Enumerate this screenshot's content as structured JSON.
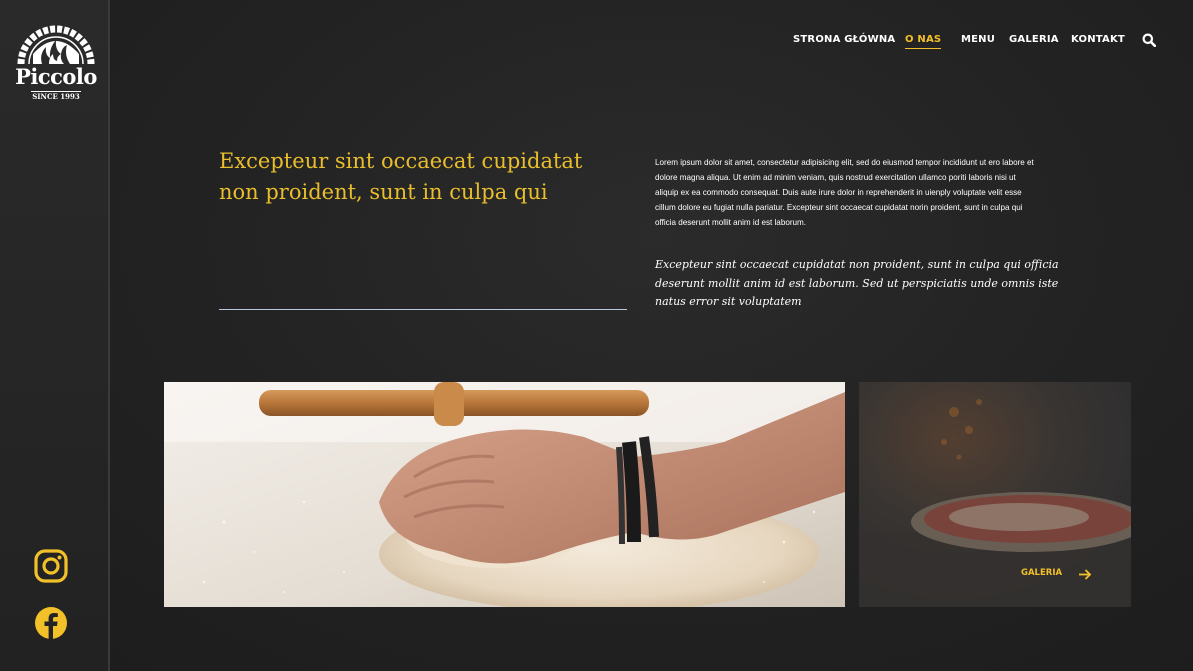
{
  "brand": {
    "logo_name": "Piccolo",
    "logo_tagline": "SINCE 1993"
  },
  "nav": {
    "items": [
      {
        "label": "STRONA GŁÓWNA",
        "active": false
      },
      {
        "label": "O NAS",
        "active": true
      },
      {
        "label": "MENU",
        "active": false
      },
      {
        "label": "GALERIA",
        "active": false
      },
      {
        "label": "KONTAKT",
        "active": false
      }
    ],
    "search_icon": "search-icon"
  },
  "about": {
    "headline_line1": "Excepteur sint occaecat cupidatat",
    "headline_line2": "non proident, sunt in culpa qui",
    "body_lines": [
      "Lorem ipsum dolor sit amet, consectetur adipisicing elit, sed do eiusmod tempor incididunt ut ero labore et",
      "dolore magna aliqua. Ut enim ad minim veniam, quis nostrud exercitation ullamco poriti laboris nisi ut",
      "aliquip ex ea commodo consequat. Duis aute irure dolor in reprehenderit in uienply voluptate velit esse",
      "cillum dolore eu fugiat nulla pariatur. Excepteur sint occaecat cupidatat norin proident, sunt in culpa qui",
      "officia deserunt mollit anim id est laborum."
    ],
    "quote_lines": [
      "Excepteur sint occaecat cupidatat non proident, sunt in culpa qui officia",
      "deserunt mollit anim id est laborum. Sed ut perspiciatis unde omnis iste",
      "natus error sit voluptatem"
    ]
  },
  "gallery": {
    "link_label": "GALERIA",
    "arrow_icon": "arrow-right-icon"
  },
  "social": {
    "icons": [
      "instagram-icon",
      "facebook-icon"
    ]
  },
  "colors": {
    "accent": "#f2c029",
    "headline": "#e9be2c",
    "background": "#232323"
  }
}
